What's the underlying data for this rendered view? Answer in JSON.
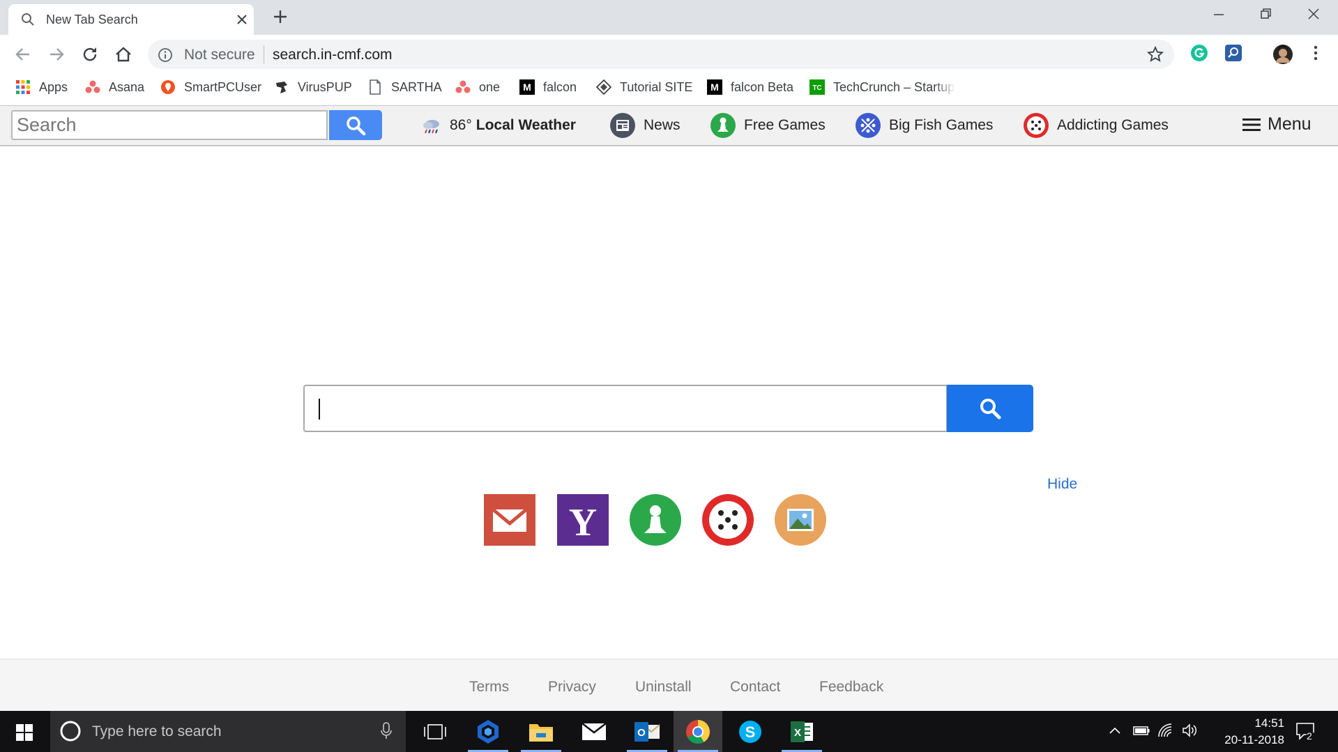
{
  "browser": {
    "tab_title": "New Tab Search",
    "security_label": "Not secure",
    "url": "search.in-cmf.com"
  },
  "bookmarks": [
    {
      "label": "Apps",
      "icon": "apps-grid-icon"
    },
    {
      "label": "Asana",
      "icon": "asana-icon"
    },
    {
      "label": "SmartPCUser",
      "icon": "smartpcuser-icon"
    },
    {
      "label": "VirusPUP",
      "icon": "viruspup-icon"
    },
    {
      "label": "SARTHA",
      "icon": "page-icon"
    },
    {
      "label": "one",
      "icon": "asana-icon"
    },
    {
      "label": "falcon",
      "icon": "medium-icon"
    },
    {
      "label": "Tutorial SITE",
      "icon": "tutorial-icon"
    },
    {
      "label": "falcon Beta",
      "icon": "medium-icon"
    },
    {
      "label": "TechCrunch – Startup",
      "icon": "techcrunch-icon"
    }
  ],
  "site_bar": {
    "search_placeholder": "Search",
    "weather_temp": "86°",
    "weather_label": "Local Weather",
    "links": [
      "News",
      "Free Games",
      "Big Fish Games",
      "Addicting Games"
    ],
    "menu_label": "Menu"
  },
  "main": {
    "hide_label": "Hide",
    "quick_links": [
      "gmail-icon",
      "yahoo-icon",
      "free-games-icon",
      "addicting-games-icon",
      "image-icon"
    ]
  },
  "footer": {
    "links": [
      "Terms",
      "Privacy",
      "Uninstall",
      "Contact",
      "Feedback"
    ]
  },
  "taskbar": {
    "search_placeholder": "Type here to search",
    "time": "14:51",
    "date": "20-11-2018",
    "notification_count": "2"
  },
  "colors": {
    "accent_blue": "#1a73e8",
    "site_search_blue": "#4a8af4",
    "link_blue": "#2a6fc9"
  }
}
